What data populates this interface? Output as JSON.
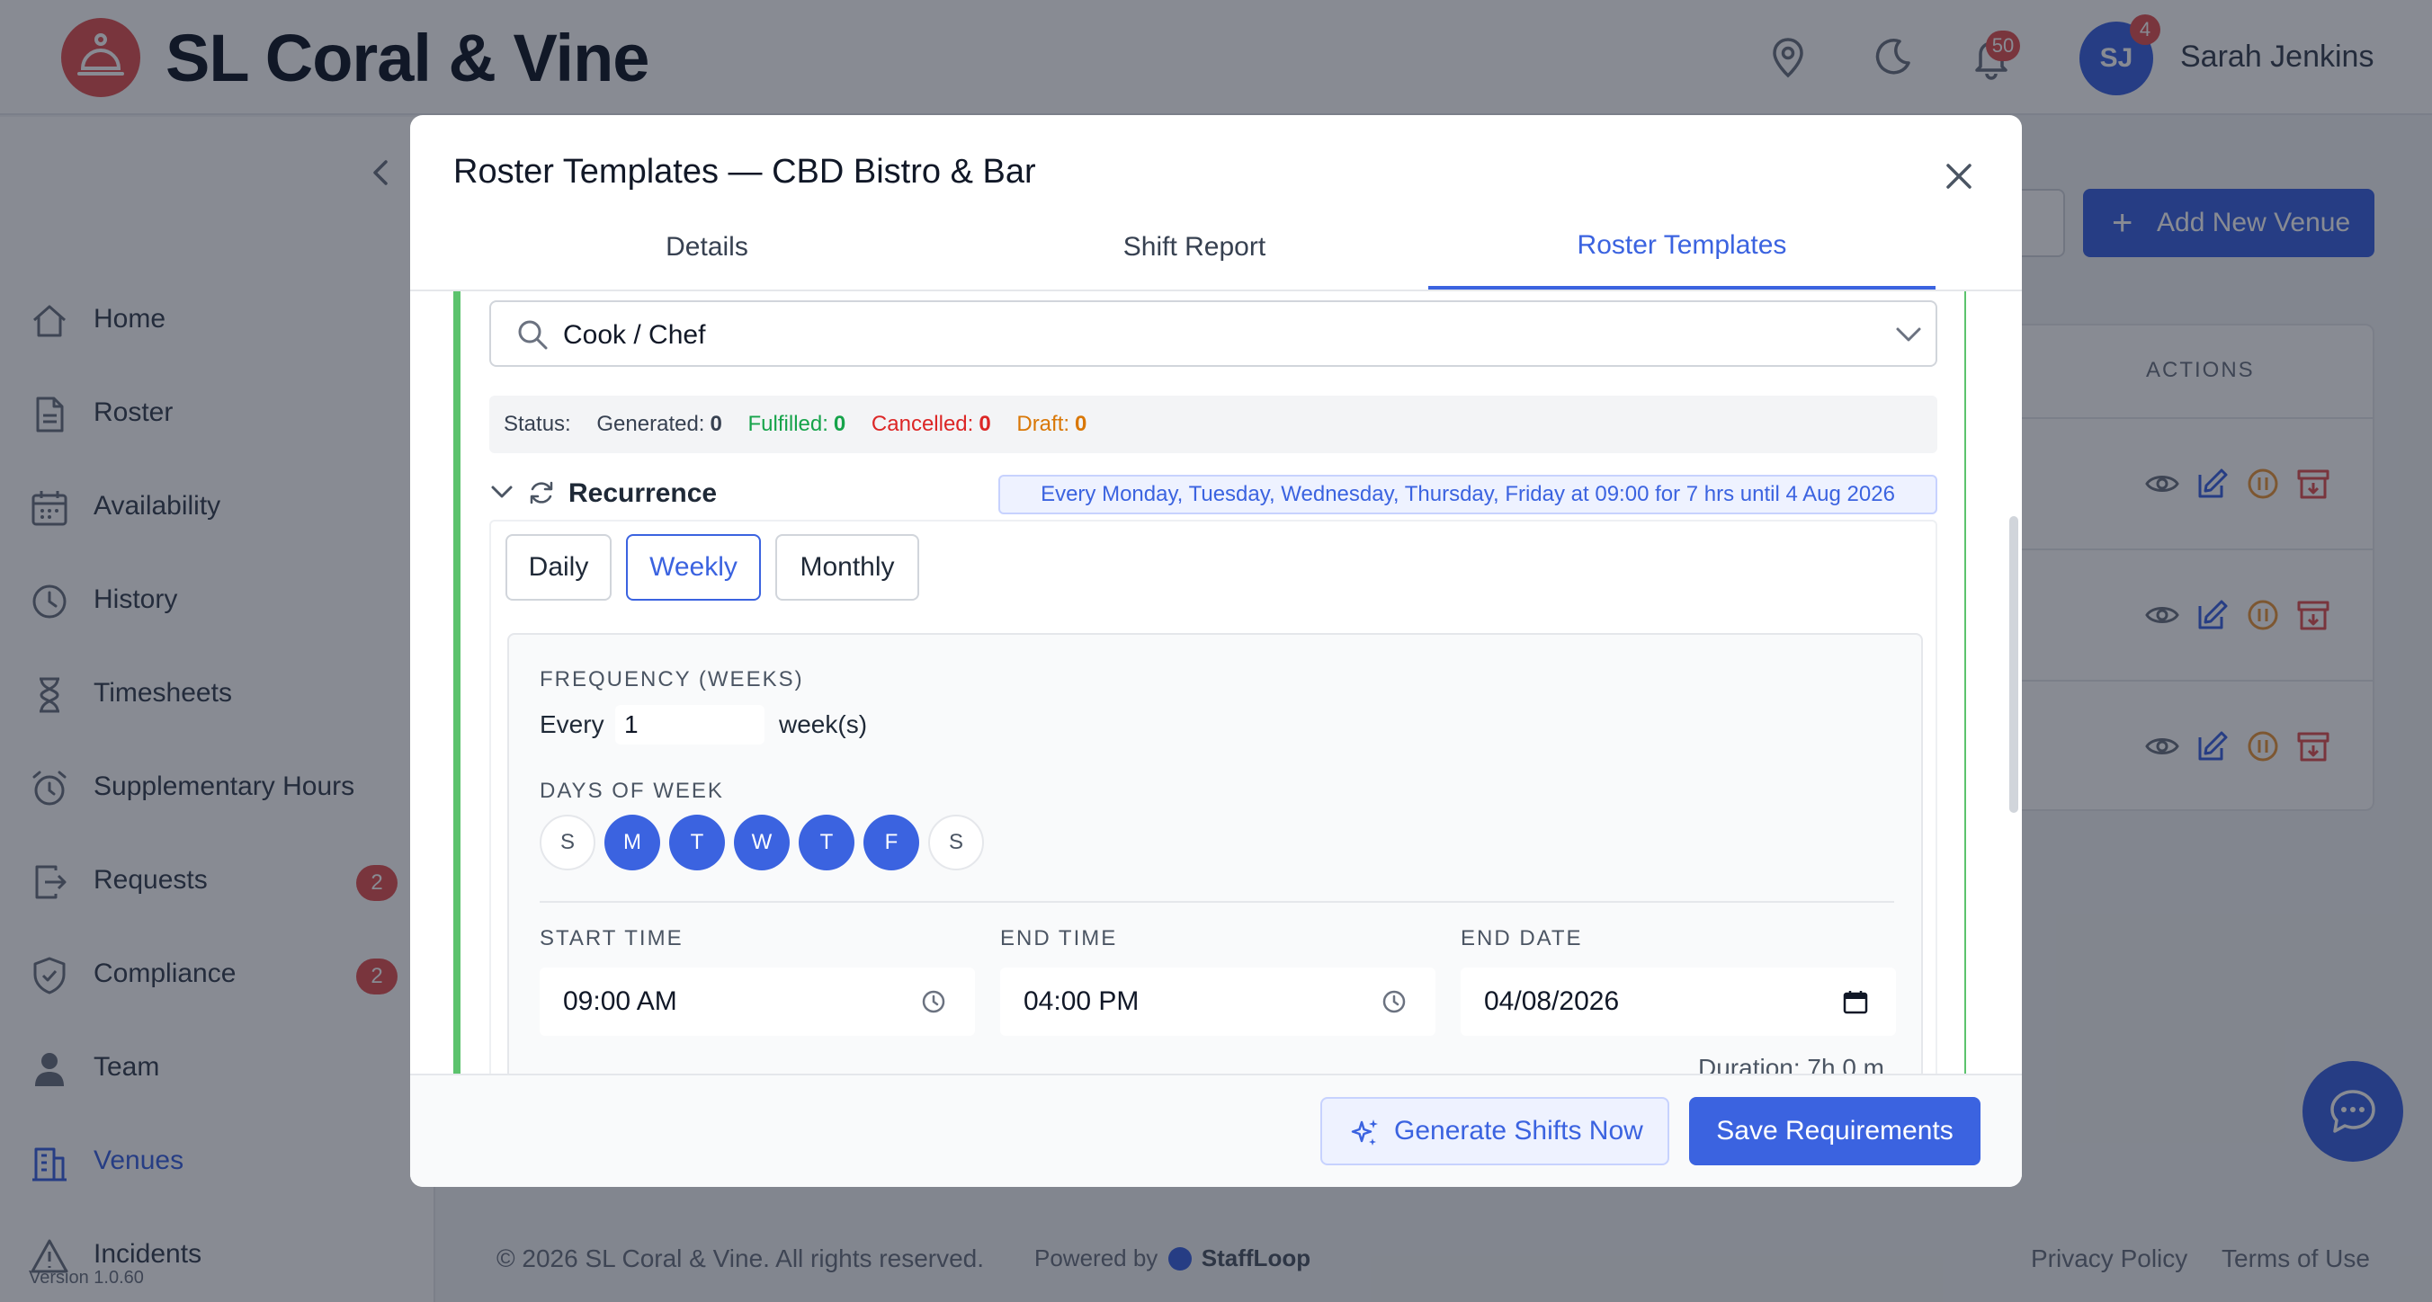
{
  "app": {
    "title": "SL Coral & Vine",
    "notification_count": "50",
    "user_initials": "SJ",
    "user_badge": "4",
    "user_name": "Sarah Jenkins"
  },
  "sidebar": {
    "items": [
      {
        "label": "Home",
        "icon": "home-icon"
      },
      {
        "label": "Roster",
        "icon": "document-icon"
      },
      {
        "label": "Availability",
        "icon": "calendar-icon"
      },
      {
        "label": "History",
        "icon": "clock-icon"
      },
      {
        "label": "Timesheets",
        "icon": "hourglass-icon"
      },
      {
        "label": "Supplementary Hours",
        "icon": "alarm-icon"
      },
      {
        "label": "Requests",
        "icon": "request-icon",
        "badge": "2"
      },
      {
        "label": "Compliance",
        "icon": "shield-icon",
        "badge": "2"
      },
      {
        "label": "Team",
        "icon": "user-icon"
      },
      {
        "label": "Venues",
        "icon": "building-icon",
        "active": true
      },
      {
        "label": "Incidents",
        "icon": "warning-icon"
      }
    ],
    "version": "Version 1.0.60"
  },
  "venues_page": {
    "add_button": "Add New Venue",
    "actions_header": "ACTIONS"
  },
  "footer": {
    "copyright": "© 2026 SL Coral & Vine. All rights reserved.",
    "powered_by": "Powered by",
    "brand": "StaffLoop",
    "privacy": "Privacy Policy",
    "terms": "Terms of Use"
  },
  "modal": {
    "title": "Roster Templates — CBD Bistro & Bar",
    "tabs": [
      {
        "label": "Details"
      },
      {
        "label": "Shift Report"
      },
      {
        "label": "Roster Templates",
        "active": true
      }
    ],
    "role": "Cook / Chef",
    "status": {
      "label": "Status:",
      "generated_label": "Generated:",
      "generated": "0",
      "fulfilled_label": "Fulfilled:",
      "fulfilled": "0",
      "cancelled_label": "Cancelled:",
      "cancelled": "0",
      "draft_label": "Draft:",
      "draft": "0"
    },
    "recurrence": {
      "label": "Recurrence",
      "summary": "Every Monday, Tuesday, Wednesday, Thursday, Friday at 09:00 for 7 hrs until 4 Aug 2026",
      "options": [
        "Daily",
        "Weekly",
        "Monthly"
      ],
      "selected": "Weekly",
      "frequency_label": "FREQUENCY (WEEKS)",
      "every_label": "Every",
      "every_value": "1",
      "weeks_label": "week(s)",
      "days_label": "DAYS OF WEEK",
      "days": [
        {
          "letter": "S",
          "on": false
        },
        {
          "letter": "M",
          "on": true
        },
        {
          "letter": "T",
          "on": true
        },
        {
          "letter": "W",
          "on": true
        },
        {
          "letter": "T",
          "on": true
        },
        {
          "letter": "F",
          "on": true
        },
        {
          "letter": "S",
          "on": false
        }
      ],
      "start_time_label": "START TIME",
      "start_time": "09:00 AM",
      "end_time_label": "END TIME",
      "end_time": "04:00 PM",
      "end_date_label": "END DATE",
      "end_date": "04/08/2026",
      "duration": "Duration: 7h 0 m"
    },
    "generate_button": "Generate Shifts Now",
    "save_button": "Save Requirements"
  },
  "colors": {
    "accent": "#3b63e0",
    "logo": "#e05252",
    "card_border": "#5cc36d",
    "fulfilled": "#16a34a",
    "cancelled": "#dc2626",
    "draft": "#d97706"
  }
}
